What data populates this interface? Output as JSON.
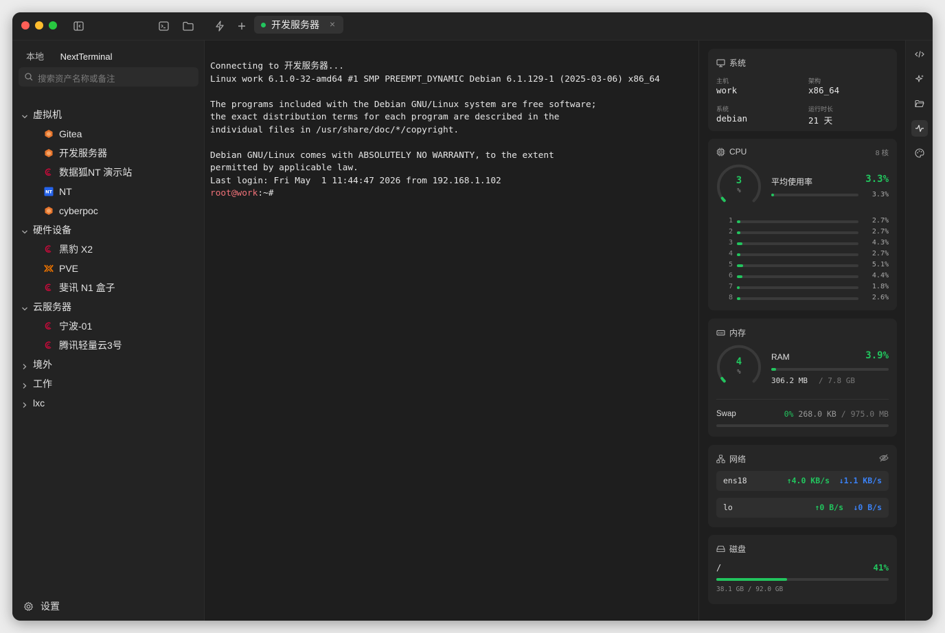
{
  "colors": {
    "accent": "#22c55e",
    "download": "#3b82f6",
    "prompt": "#f07178"
  },
  "tab": {
    "title": "开发服务器",
    "close": "×"
  },
  "sidebar": {
    "tabs": [
      "本地",
      "NextTerminal"
    ],
    "search_placeholder": "搜索资产名称或备注",
    "groups": [
      {
        "label": "虚拟机",
        "expanded": true,
        "items": [
          {
            "label": "Gitea",
            "icon": "ubuntu-icon"
          },
          {
            "label": "开发服务器",
            "icon": "ubuntu-icon"
          },
          {
            "label": "数据狐NT 演示站",
            "icon": "debian-icon"
          },
          {
            "label": "NT",
            "icon": "nt-icon"
          },
          {
            "label": "cyberpoc",
            "icon": "ubuntu-icon"
          }
        ]
      },
      {
        "label": "硬件设备",
        "expanded": true,
        "items": [
          {
            "label": "黑豹 X2",
            "icon": "debian-icon"
          },
          {
            "label": "PVE",
            "icon": "proxmox-icon"
          },
          {
            "label": "斐讯 N1 盒子",
            "icon": "debian-icon"
          }
        ]
      },
      {
        "label": "云服务器",
        "expanded": true,
        "items": [
          {
            "label": "宁波-01",
            "icon": "debian-icon"
          },
          {
            "label": "腾讯轻量云3号",
            "icon": "debian-icon"
          }
        ]
      },
      {
        "label": "境外",
        "expanded": false,
        "items": []
      },
      {
        "label": "工作",
        "expanded": false,
        "items": []
      },
      {
        "label": "lxc",
        "expanded": false,
        "items": []
      }
    ],
    "settings_label": "设置"
  },
  "terminal": {
    "lines": [
      "Connecting to 开发服务器...",
      "Linux work 6.1.0-32-amd64 #1 SMP PREEMPT_DYNAMIC Debian 6.1.129-1 (2025-03-06) x86_64",
      "",
      "The programs included with the Debian GNU/Linux system are free software;",
      "the exact distribution terms for each program are described in the",
      "individual files in /usr/share/doc/*/copyright.",
      "",
      "Debian GNU/Linux comes with ABSOLUTELY NO WARRANTY, to the extent",
      "permitted by applicable law.",
      "Last login: Fri May  1 11:44:47 2026 from 192.168.1.102"
    ],
    "prompt_user": "root@work",
    "prompt_rest": ":~#"
  },
  "system": {
    "title": "系统",
    "host_label": "主机",
    "host": "work",
    "arch_label": "架构",
    "arch": "x86_64",
    "os_label": "系统",
    "os": "debian",
    "uptime_label": "运行时长",
    "uptime": "21 天"
  },
  "cpu": {
    "title": "CPU",
    "cores_label": "8 核",
    "gauge_value": "3",
    "gauge_unit": "%",
    "avg_label": "平均使用率",
    "avg_pct": "3.3%",
    "avg_pct_small": "3.3%",
    "avg_fraction": 0.033,
    "cores": [
      {
        "id": "1",
        "pct": "2.7%",
        "value": 2.7
      },
      {
        "id": "2",
        "pct": "2.7%",
        "value": 2.7
      },
      {
        "id": "3",
        "pct": "4.3%",
        "value": 4.3
      },
      {
        "id": "4",
        "pct": "2.7%",
        "value": 2.7
      },
      {
        "id": "5",
        "pct": "5.1%",
        "value": 5.1
      },
      {
        "id": "6",
        "pct": "4.4%",
        "value": 4.4
      },
      {
        "id": "7",
        "pct": "1.8%",
        "value": 1.8
      },
      {
        "id": "8",
        "pct": "2.6%",
        "value": 2.6
      }
    ]
  },
  "memory": {
    "title": "内存",
    "gauge_value": "4",
    "gauge_unit": "%",
    "ram_label": "RAM",
    "ram_pct": "3.9%",
    "ram_fraction": 0.039,
    "ram_used": "306.2 MB",
    "ram_total": "/ 7.8 GB",
    "swap_label": "Swap",
    "swap_pct": "0%",
    "swap_used": "268.0 KB",
    "swap_total": "/ 975.0 MB"
  },
  "network": {
    "title": "网络",
    "interfaces": [
      {
        "name": "ens18",
        "up": "↑4.0 KB/s",
        "down": "↓1.1 KB/s"
      },
      {
        "name": "lo",
        "up": "↑0 B/s",
        "down": "↓0 B/s"
      }
    ]
  },
  "disk": {
    "title": "磁盘",
    "mount": "/",
    "pct": "41%",
    "fraction": 0.41,
    "usage": "38.1 GB / 92.0 GB"
  }
}
